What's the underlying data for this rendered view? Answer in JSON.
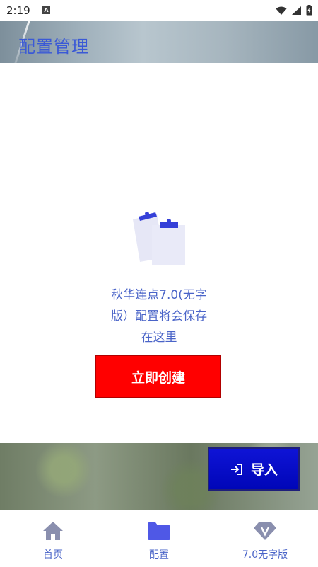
{
  "status_bar": {
    "time": "2:19",
    "icons": [
      "a-icon",
      "wifi-icon",
      "signal-icon",
      "battery-icon"
    ]
  },
  "header": {
    "title": "配置管理"
  },
  "empty_state": {
    "icon": "clipboard-icon",
    "message_lines": [
      "秋华连点7.0(无字",
      "版）配置将会保存",
      "在这里"
    ]
  },
  "actions": {
    "create_label": "立即创建",
    "import_label": "导入",
    "import_icon": "login-icon"
  },
  "bottom_nav": {
    "items": [
      {
        "label": "首页",
        "icon": "home-icon"
      },
      {
        "label": "配置",
        "icon": "folder-icon"
      },
      {
        "label": "7.0无字版",
        "icon": "gem-icon"
      }
    ],
    "selected": "配置"
  },
  "colors": {
    "accent": "#4A64C8",
    "title": "#3A59D6",
    "create_button": "#FF0000",
    "import_button": "#0F14D6",
    "nav_icon_inactive": "#8A8FAE",
    "nav_icon_active": "#4F58E6"
  }
}
